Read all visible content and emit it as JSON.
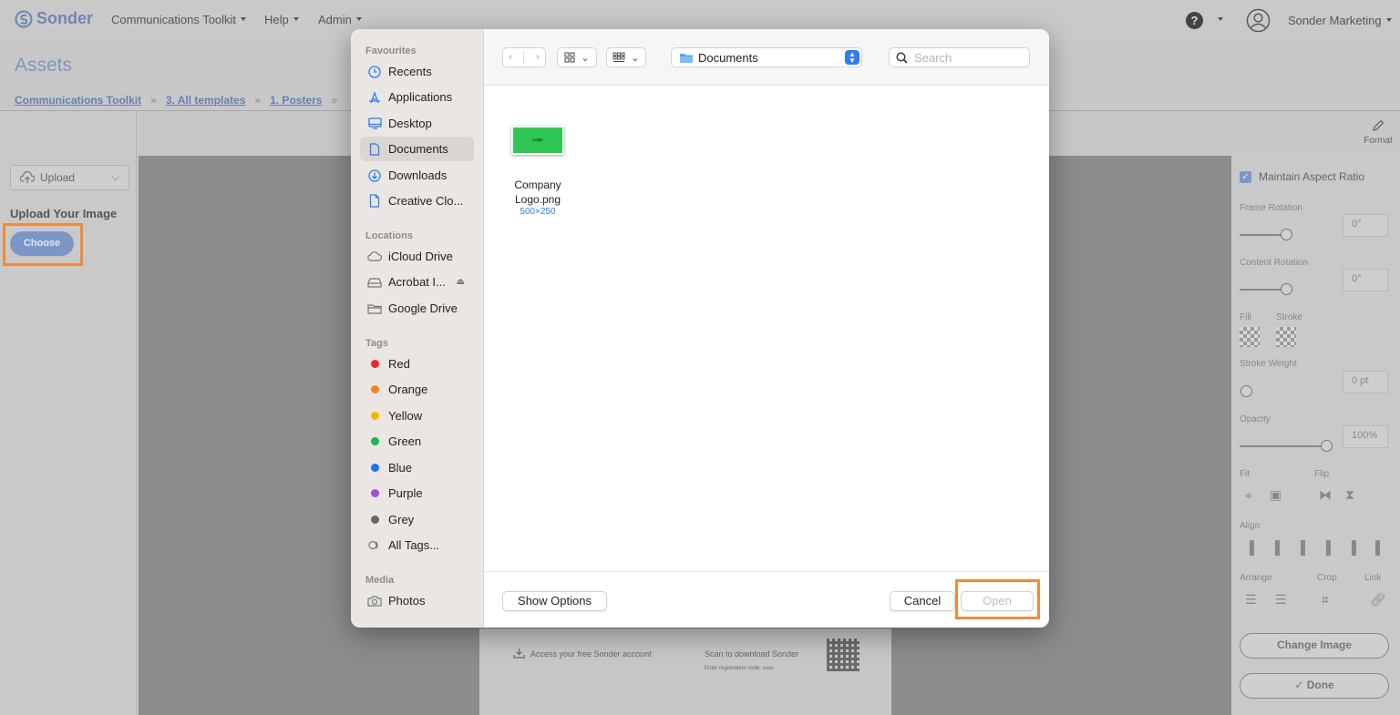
{
  "app": {
    "brand": "Sonder",
    "nav": [
      {
        "label": "Communications Toolkit"
      },
      {
        "label": "Help"
      },
      {
        "label": "Admin"
      }
    ],
    "help_glyph": "?",
    "user_name": "Sonder Marketing",
    "page_title": "Assets",
    "breadcrumb": [
      "Communications Toolkit",
      "3. All templates",
      "1. Posters"
    ],
    "breadcrumb_sep": "»",
    "left_panel": {
      "upload_select": "Upload",
      "heading": "Upload Your Image",
      "choose_label": "Choose"
    },
    "poster": {
      "access_text": "Access your free Sonder account",
      "scan_text": "Scan to download Sonder",
      "reg_text": "Enter registration code: xxxx"
    },
    "right_panel": {
      "format_label": "Format",
      "maintain_aspect": "Maintain Aspect Ratio",
      "frame_rotation": "Frame Rotation",
      "frame_rotation_value": "0°",
      "content_rotation": "Content Rotation",
      "content_rotation_value": "0°",
      "fill": "Fill",
      "stroke": "Stroke",
      "stroke_weight": "Stroke Weight",
      "stroke_weight_value": "0 pt",
      "opacity": "Opacity",
      "opacity_value": "100%",
      "fit": "Fit",
      "flip": "Flip",
      "align": "Align",
      "arrange": "Arrange",
      "crop": "Crop",
      "link": "Link",
      "change_image": "Change Image",
      "done": "Done"
    }
  },
  "dialog": {
    "sections": {
      "favourites": "Favourites",
      "locations": "Locations",
      "tags": "Tags",
      "media": "Media"
    },
    "favourites": [
      {
        "label": "Recents",
        "icon": "clock-icon"
      },
      {
        "label": "Applications",
        "icon": "applications-icon"
      },
      {
        "label": "Desktop",
        "icon": "desktop-icon"
      },
      {
        "label": "Documents",
        "icon": "document-icon",
        "active": true
      },
      {
        "label": "Downloads",
        "icon": "download-icon"
      },
      {
        "label": "Creative Clo...",
        "icon": "file-icon"
      }
    ],
    "locations": [
      {
        "label": "iCloud Drive",
        "icon": "cloud-icon"
      },
      {
        "label": "Acrobat I...",
        "icon": "drive-icon"
      },
      {
        "label": "Google Drive",
        "icon": "folder-icon"
      }
    ],
    "tags": [
      {
        "label": "Red",
        "color": "#f0262d"
      },
      {
        "label": "Orange",
        "color": "#f7821b"
      },
      {
        "label": "Yellow",
        "color": "#f7b500"
      },
      {
        "label": "Green",
        "color": "#1db840"
      },
      {
        "label": "Blue",
        "color": "#1a73f0"
      },
      {
        "label": "Purple",
        "color": "#a44ed6"
      },
      {
        "label": "Grey",
        "color": "#666666"
      },
      {
        "label": "All Tags...",
        "color": null
      }
    ],
    "media": [
      {
        "label": "Photos",
        "icon": "camera-icon"
      }
    ],
    "location": "Documents",
    "search_placeholder": "Search",
    "file": {
      "name": "Company Logo.png",
      "dimensions": "500×250",
      "thumb_text": "Logo"
    },
    "show_options": "Show Options",
    "cancel": "Cancel",
    "open": "Open"
  },
  "colors": {
    "accent_blue": "#2f7cf6",
    "highlight_orange": "#f08a3a",
    "logo_green": "#2fc655"
  }
}
